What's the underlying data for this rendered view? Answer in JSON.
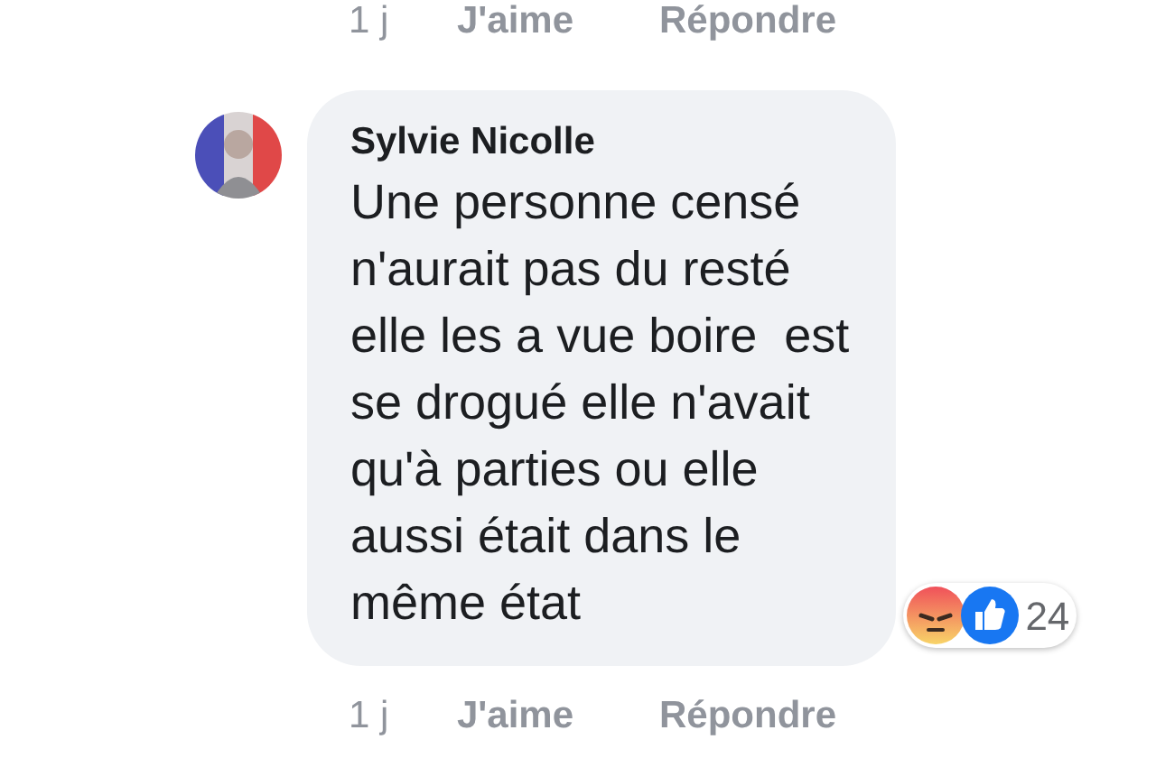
{
  "previous_comment_actions": {
    "time": "1 j",
    "like": "J'aime",
    "reply": "Répondre"
  },
  "comment": {
    "author": "Sylvie Nicolle",
    "text": "Une personne censé\nn'aurait pas du resté\nelle les a vue boire  est\nse drogué elle n'avait\nqu'à parties ou elle\naussi était dans le\nmême état",
    "reactions": {
      "count": "24"
    },
    "actions": {
      "time": "1 j",
      "like": "J'aime",
      "reply": "Répondre"
    }
  }
}
